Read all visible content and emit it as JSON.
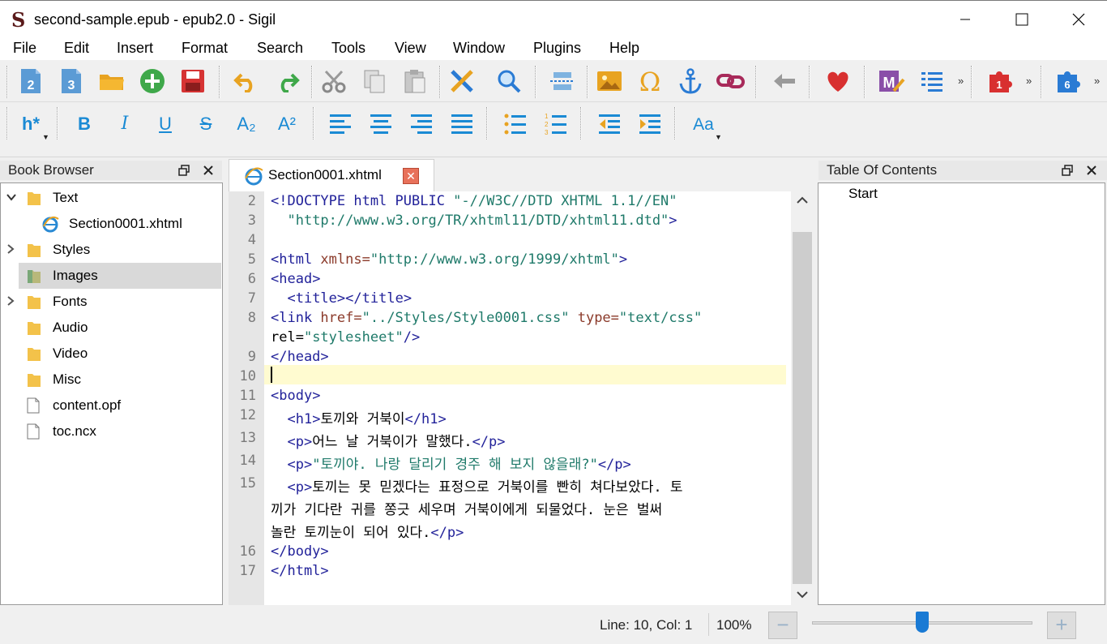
{
  "window": {
    "title": "second-sample.epub - epub2.0 - Sigil",
    "logo": "S"
  },
  "menu": [
    "File",
    "Edit",
    "Insert",
    "Format",
    "Search",
    "Tools",
    "View",
    "Window",
    "Plugins",
    "Help"
  ],
  "toolbar": {
    "fmt_heading": "h*",
    "fmt_bold": "B",
    "fmt_italic": "I",
    "fmt_underline": "U",
    "fmt_strike": "S",
    "fmt_sub": "A₂",
    "fmt_sup": "A²",
    "case_label": "Aa",
    "plugin_badge_1": "1",
    "plugin_badge_6": "6"
  },
  "book_browser": {
    "title": "Book Browser",
    "items": [
      {
        "label": "Text",
        "type": "folder",
        "expanded": true
      },
      {
        "label": "Section0001.xhtml",
        "type": "file-html"
      },
      {
        "label": "Styles",
        "type": "folder",
        "expanded": false
      },
      {
        "label": "Images",
        "type": "folder",
        "selected": true
      },
      {
        "label": "Fonts",
        "type": "folder",
        "expanded": false
      },
      {
        "label": "Audio",
        "type": "folder"
      },
      {
        "label": "Video",
        "type": "folder"
      },
      {
        "label": "Misc",
        "type": "folder"
      },
      {
        "label": "content.opf",
        "type": "file"
      },
      {
        "label": "toc.ncx",
        "type": "file"
      }
    ]
  },
  "editor": {
    "tab_label": "Section0001.xhtml",
    "current_line": 10,
    "lines": [
      {
        "n": "2",
        "text": "<!DOCTYPE html PUBLIC \"-//W3C//DTD XHTML 1.1//EN\""
      },
      {
        "n": "3",
        "text": "  \"http://www.w3.org/TR/xhtml11/DTD/xhtml11.dtd\">"
      },
      {
        "n": "4",
        "text": ""
      },
      {
        "n": "5",
        "text": "<html xmlns=\"http://www.w3.org/1999/xhtml\">"
      },
      {
        "n": "6",
        "text": "<head>"
      },
      {
        "n": "7",
        "text": "  <title></title>"
      },
      {
        "n": "8",
        "text": "<link href=\"../Styles/Style0001.css\" type=\"text/css\""
      },
      {
        "n": "",
        "text": "rel=\"stylesheet\"/>"
      },
      {
        "n": "9",
        "text": "</head>"
      },
      {
        "n": "10",
        "text": ""
      },
      {
        "n": "11",
        "text": "<body>"
      },
      {
        "n": "12",
        "text": "  <h1>토끼와 거북이</h1>"
      },
      {
        "n": "13",
        "text": "  <p>어느 날 거북이가 말했다.</p>"
      },
      {
        "n": "14",
        "text": "  <p>\"토끼야. 나랑 달리기 경주 해 보지 않을래?\"</p>"
      },
      {
        "n": "15",
        "text": "  <p>토끼는 못 믿겠다는 표정으로 거북이를 빤히 쳐다보았다. 토"
      },
      {
        "n": "",
        "text": "끼가 기다란 귀를 쫑긋 세우며 거북이에게 되물었다. 눈은 벌써"
      },
      {
        "n": "",
        "text": "놀란 토끼눈이 되어 있다.</p>"
      },
      {
        "n": "16",
        "text": "</body>"
      },
      {
        "n": "17",
        "text": "</html>"
      }
    ]
  },
  "toc": {
    "title": "Table Of Contents",
    "items": [
      "Start"
    ]
  },
  "status": {
    "position": "Line: 10, Col: 1",
    "zoom": "100%",
    "zoom_out": "−",
    "zoom_in": "+",
    "zoom_fraction": 0.5
  }
}
